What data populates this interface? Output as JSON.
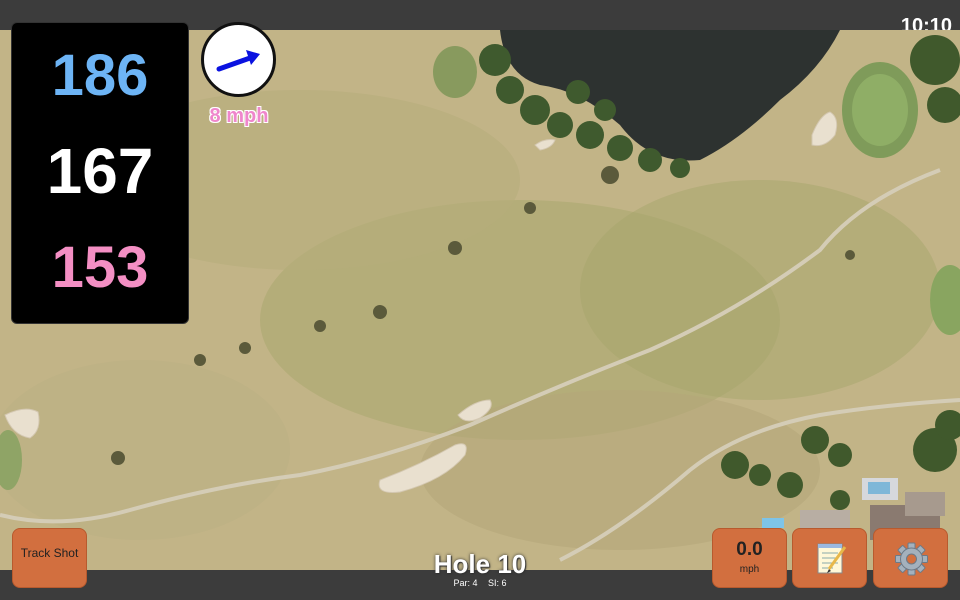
{
  "status_bar": {
    "time": "10:10"
  },
  "distances": {
    "back": "186",
    "middle": "167",
    "front": "153"
  },
  "wind": {
    "speed_label": "8 mph",
    "direction_icon": "wind-arrow-icon"
  },
  "buttons": {
    "track_shot_label": "Track Shot",
    "wind_value": "0.0",
    "wind_unit": "mph",
    "notes_icon": "notepad-icon",
    "settings_icon": "gear-icon"
  },
  "hole": {
    "title": "Hole 10",
    "par": "Par: 4",
    "si": "SI: 6"
  },
  "colors": {
    "back_distance": "#6db4f5",
    "middle_distance": "#ffffff",
    "front_distance": "#f48fc4",
    "wind_label": "#ef86cc",
    "button": "#d26f3f",
    "arrow": "#0a12e0"
  }
}
